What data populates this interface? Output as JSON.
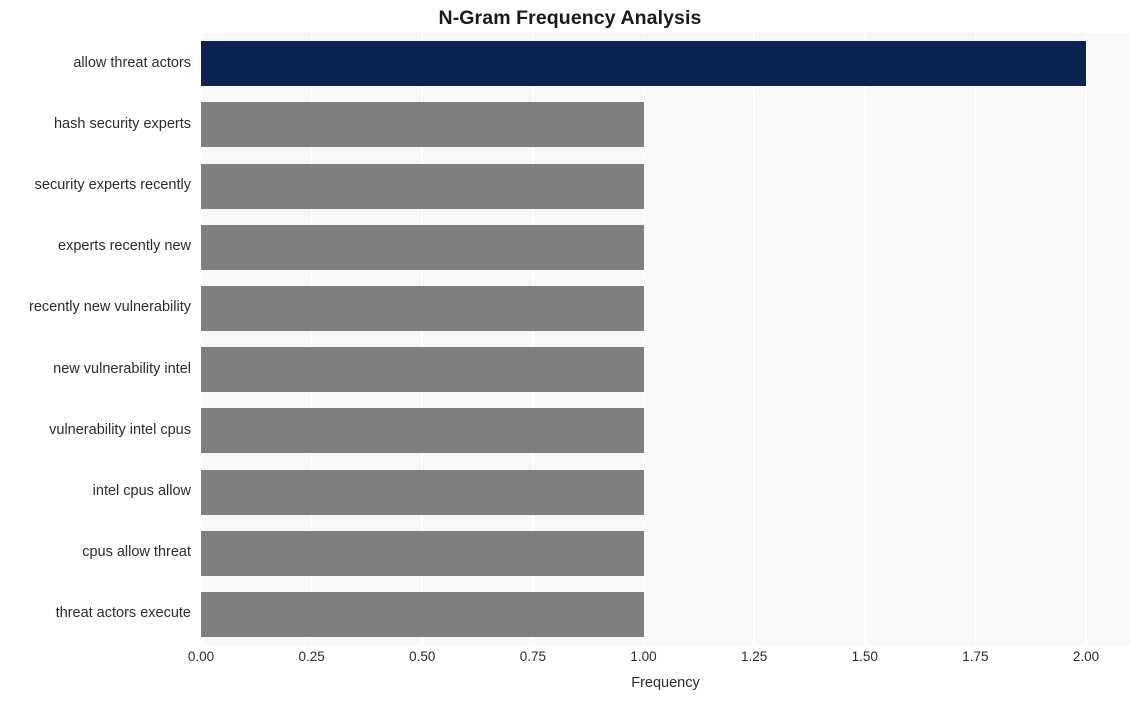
{
  "chart_data": {
    "type": "bar",
    "orientation": "horizontal",
    "title": "N-Gram Frequency Analysis",
    "xlabel": "Frequency",
    "ylabel": "",
    "xlim": [
      0,
      2.0
    ],
    "xticks": [
      "0.00",
      "0.25",
      "0.50",
      "0.75",
      "1.00",
      "1.25",
      "1.50",
      "1.75",
      "2.00"
    ],
    "xtick_values": [
      0,
      0.25,
      0.5,
      0.75,
      1.0,
      1.25,
      1.5,
      1.75,
      2.0
    ],
    "grid": true,
    "grid_axis": "x",
    "legend": null,
    "categories": [
      "allow threat actors",
      "hash security experts",
      "security experts recently",
      "experts recently new",
      "recently new vulnerability",
      "new vulnerability intel",
      "vulnerability intel cpus",
      "intel cpus allow",
      "cpus allow threat",
      "threat actors execute"
    ],
    "values": [
      2,
      1,
      1,
      1,
      1,
      1,
      1,
      1,
      1,
      1
    ],
    "bar_colors": [
      "#0a2351",
      "#7f7f7f",
      "#7f7f7f",
      "#7f7f7f",
      "#7f7f7f",
      "#7f7f7f",
      "#7f7f7f",
      "#7f7f7f",
      "#7f7f7f",
      "#7f7f7f"
    ]
  },
  "style": {
    "plot_background": "#f7f7f7",
    "figure_background": "#ffffff",
    "gridline_color": "#ffffff",
    "highlight_color": "#0a2351",
    "default_bar_color": "#7f7f7f",
    "text_color": "#2b2b2b",
    "title_color": "#1a1a1a"
  }
}
